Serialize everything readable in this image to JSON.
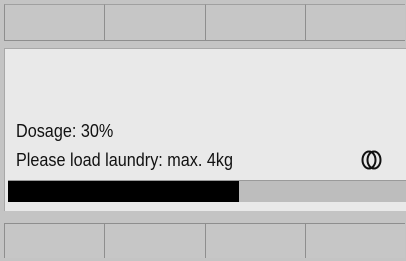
{
  "display": {
    "dosage_text": "Dosage: 30%",
    "instruction_text": "Please load laundry: max. 4kg",
    "drum_icon": "drum-icon",
    "progress": 0.58
  },
  "colors": {
    "frame": "#c4c4c4",
    "screen": "#e9e9e9",
    "bar_fill": "#000000",
    "bar_track": "#bdbdbd"
  },
  "buttons": {
    "top": [
      "",
      "",
      "",
      ""
    ],
    "bottom": [
      "",
      "",
      "",
      ""
    ]
  }
}
